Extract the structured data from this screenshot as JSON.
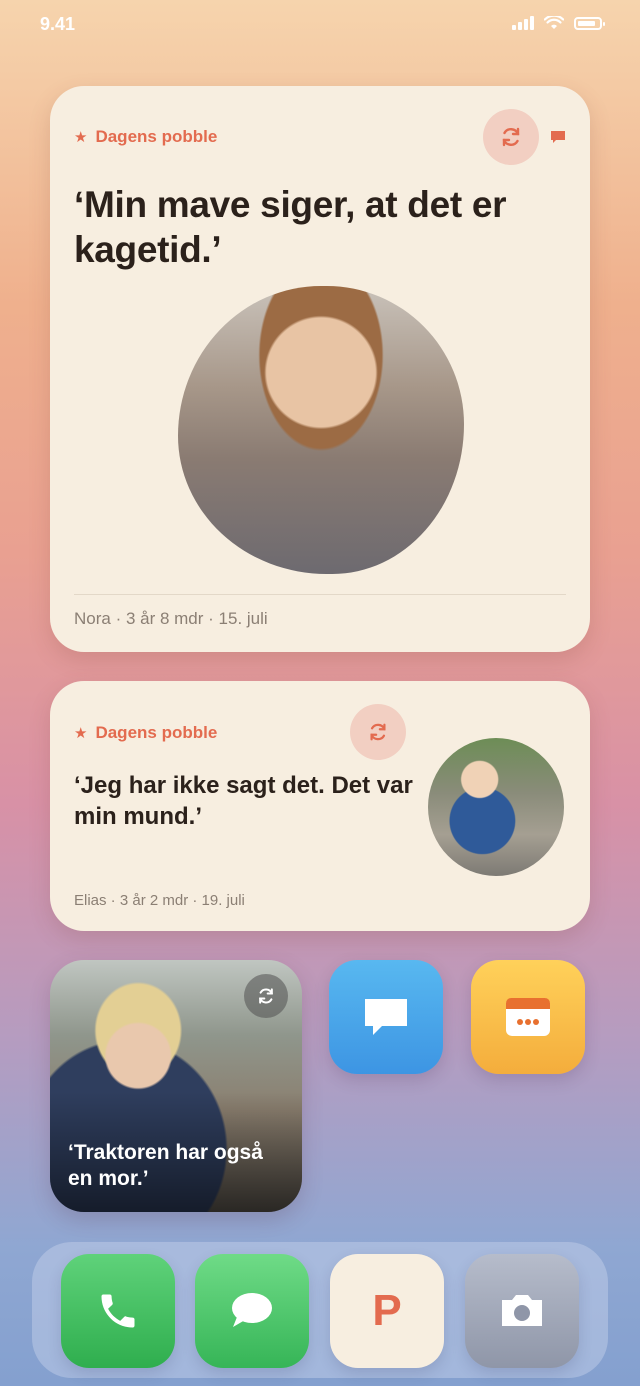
{
  "status_bar": {
    "time": "9.41"
  },
  "widget_large": {
    "tag": "Dagens pobble",
    "quote": "‘Min mave siger, at det er kagetid.’",
    "meta": "Nora · 3 år 8 mdr · 15. juli",
    "icons": [
      "star-icon",
      "refresh-icon",
      "comment-icon"
    ]
  },
  "widget_medium": {
    "tag": "Dagens pobble",
    "quote": "‘Jeg har ikke sagt det. Det var min mund.’",
    "meta": "Elias · 3 år 2 mdr · 19. juli",
    "icons": [
      "star-icon",
      "refresh-icon"
    ]
  },
  "widget_small": {
    "quote": "‘Traktoren har også en mor.’",
    "icons": [
      "refresh-icon"
    ]
  },
  "apps": {
    "messages_blue_icon": "chat-bubble-icon",
    "calendar_icon": "calendar-icon",
    "dock": [
      "phone-icon",
      "message-icon",
      "pobble-app",
      "camera-icon"
    ],
    "pobble_letter": "P"
  },
  "colors": {
    "accent": "#e36b4f",
    "card_bg": "#f7eee0",
    "text_dark": "#2b211b",
    "meta_text": "#8b7f74"
  }
}
